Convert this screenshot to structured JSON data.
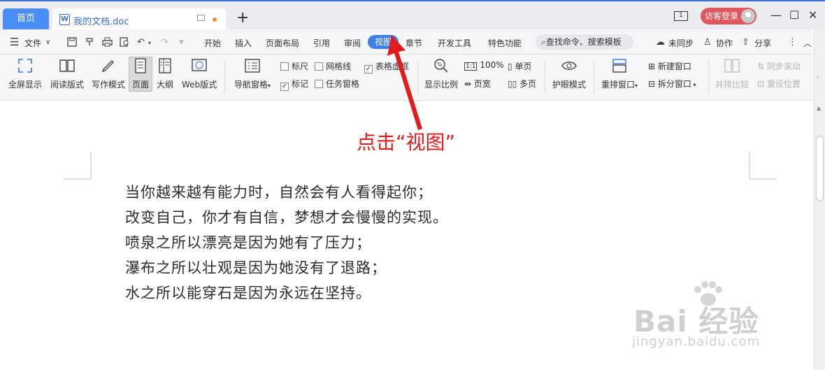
{
  "titlebar": {
    "home_tab": "首页",
    "doc_tab": "我的文档.doc",
    "add_tab": "+",
    "window_badge": "1",
    "login": "访客登录",
    "minimize": "—",
    "maximize": "☐",
    "close": "✕"
  },
  "menubar": {
    "file": "文件",
    "items": [
      "开始",
      "插入",
      "页面布局",
      "引用",
      "审阅",
      "视图",
      "章节",
      "开发工具",
      "特色功能"
    ],
    "active": "视图",
    "search": "查找命令、搜索模板",
    "sync": "未同步",
    "collab": "协作",
    "share": "分享"
  },
  "ribbon": {
    "fullscreen": "全屏显示",
    "reading": "阅读版式",
    "writing": "写作模式",
    "page": "页面",
    "outline": "大纲",
    "web": "Web版式",
    "nav_pane": "导航窗格",
    "ruler": "标尺",
    "gridlines": "网格线",
    "table_border": "表格虚框",
    "marks": "标记",
    "task_pane": "任务窗格",
    "zoom": "显示比例",
    "zoom_100": "100%",
    "single_page": "单页",
    "page_width": "页宽",
    "multi_page": "多页",
    "eye_mode": "护眼模式",
    "rearrange": "重排窗口",
    "new_window": "新建窗口",
    "split_window": "拆分窗口",
    "side_by_side": "并排比较",
    "sync_scroll": "同步滚动",
    "reset_pos": "重设位置"
  },
  "document": {
    "lines": [
      "当你越来越有能力时，自然会有人看得起你；",
      "改变自己，你才有自信，梦想才会慢慢的实现。",
      "喷泉之所以漂亮是因为她有了压力；",
      "瀑布之所以壮观是因为她没有了退路；",
      "水之所以能穿石是因为永远在坚持。"
    ]
  },
  "annotation": "点击“视图”",
  "watermark": {
    "brand": "Bai 经验",
    "url": "jingyan.baidu.com"
  },
  "colors": {
    "accent": "#3f7fe8",
    "annotation": "#e21c1c",
    "login": "#e0585e"
  }
}
